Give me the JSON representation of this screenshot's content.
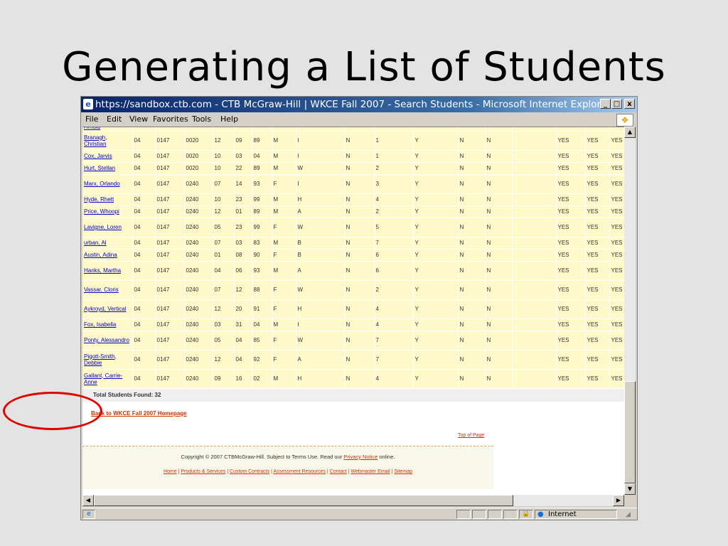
{
  "slide": {
    "title": "Generating a List of Students"
  },
  "window": {
    "title": "https://sandbox.ctb.com - CTB McGraw-Hill | WKCE Fall 2007 - Search Students - Microsoft Internet Explorer",
    "controls": {
      "minimize": "_",
      "maximize": "□",
      "close": "x"
    }
  },
  "menu": {
    "items": [
      "File",
      "Edit",
      "View",
      "Favorites",
      "Tools",
      "Help"
    ]
  },
  "table": {
    "partial_top_name": "Arnold",
    "rows": [
      [
        "Branagh, Christian",
        "04",
        "0147",
        "0020",
        "12",
        "09",
        "89",
        "M",
        "I",
        "N",
        "1",
        "Y",
        "N",
        "N",
        "",
        "YES",
        "YES",
        "YES"
      ],
      [
        "Cox, Jarvis",
        "04",
        "0147",
        "0020",
        "10",
        "03",
        "04",
        "M",
        "I",
        "N",
        "1",
        "Y",
        "N",
        "N",
        "",
        "YES",
        "YES",
        "YES"
      ],
      [
        "Hurt, Stellan",
        "04",
        "0147",
        "0020",
        "10",
        "22",
        "89",
        "M",
        "W",
        "N",
        "2",
        "Y",
        "N",
        "N",
        "",
        "YES",
        "YES",
        "YES"
      ],
      [
        "Marx, Orlando",
        "04",
        "0147",
        "0240",
        "07",
        "14",
        "93",
        "F",
        "I",
        "N",
        "3",
        "Y",
        "N",
        "N",
        "",
        "YES",
        "YES",
        "YES"
      ],
      [
        "Hyde, Rhett",
        "04",
        "0147",
        "0240",
        "10",
        "23",
        "99",
        "M",
        "H",
        "N",
        "4",
        "Y",
        "N",
        "N",
        "",
        "YES",
        "YES",
        "YES"
      ],
      [
        "Price, Whoopi",
        "04",
        "0147",
        "0240",
        "12",
        "01",
        "89",
        "M",
        "A",
        "N",
        "2",
        "Y",
        "N",
        "N",
        "",
        "YES",
        "YES",
        "YES"
      ],
      [
        "Lavigne, Loren",
        "04",
        "0147",
        "0240",
        "05",
        "23",
        "99",
        "F",
        "W",
        "N",
        "5",
        "Y",
        "N",
        "N",
        "",
        "YES",
        "YES",
        "YES"
      ],
      [
        "urban, Al",
        "04",
        "0147",
        "0240",
        "07",
        "03",
        "83",
        "M",
        "B",
        "N",
        "7",
        "Y",
        "N",
        "N",
        "",
        "YES",
        "YES",
        "YES"
      ],
      [
        "Austin, Adina",
        "04",
        "0147",
        "0240",
        "01",
        "08",
        "90",
        "F",
        "B",
        "N",
        "6",
        "Y",
        "N",
        "N",
        "",
        "YES",
        "YES",
        "YES"
      ],
      [
        "Hanks, Martha",
        "04",
        "0147",
        "0240",
        "04",
        "06",
        "93",
        "M",
        "A",
        "N",
        "6",
        "Y",
        "N",
        "N",
        "",
        "YES",
        "YES",
        "YES"
      ],
      [
        "Vassar, Cloris",
        "04",
        "0147",
        "0240",
        "07",
        "12",
        "88",
        "F",
        "W",
        "N",
        "2",
        "Y",
        "N",
        "N",
        "",
        "YES",
        "YES",
        "YES"
      ],
      [
        "Aykroyd, Vertical",
        "04",
        "0147",
        "0240",
        "12",
        "20",
        "91",
        "F",
        "H",
        "N",
        "4",
        "Y",
        "N",
        "N",
        "",
        "YES",
        "YES",
        "YES"
      ],
      [
        "Fox, Isabella",
        "04",
        "0147",
        "0240",
        "03",
        "31",
        "04",
        "M",
        "I",
        "N",
        "4",
        "Y",
        "N",
        "N",
        "",
        "YES",
        "YES",
        "YES"
      ],
      [
        "Ponty, Alessandro",
        "04",
        "0147",
        "0240",
        "05",
        "04",
        "85",
        "F",
        "W",
        "N",
        "7",
        "Y",
        "N",
        "N",
        "",
        "YES",
        "YES",
        "YES"
      ],
      [
        "Pigott-Smith, Debbie",
        "04",
        "0147",
        "0240",
        "12",
        "04",
        "92",
        "F",
        "A",
        "N",
        "7",
        "Y",
        "N",
        "N",
        "",
        "YES",
        "YES",
        "YES"
      ],
      [
        "Gallant, Carrie-Anne",
        "04",
        "0147",
        "0240",
        "09",
        "16",
        "02",
        "M",
        "H",
        "N",
        "4",
        "Y",
        "N",
        "N",
        "",
        "YES",
        "YES",
        "YES"
      ]
    ]
  },
  "total": {
    "label": "Total Students Found: 32"
  },
  "links": {
    "back": "Back to WKCE Fall 2007 Homepage",
    "top_of_page": "Top of Page"
  },
  "footer": {
    "copyright_prefix": "Copyright © 2007 CTBMcGraw-Hill. Subject to Terms Use. Read our ",
    "privacy": "Privacy Notice",
    "copyright_suffix": " online.",
    "links": [
      "Home",
      "Products & Services",
      "Custom Contracts",
      "Assessment Resources",
      "Contact",
      "Webmaster Email",
      "Sitemap"
    ]
  },
  "status": {
    "zone": "Internet"
  },
  "colors": {
    "row_bg": "#fff8c8",
    "link": "#0000cc",
    "footer_link": "#cc3300",
    "highlight": "#e00000"
  }
}
